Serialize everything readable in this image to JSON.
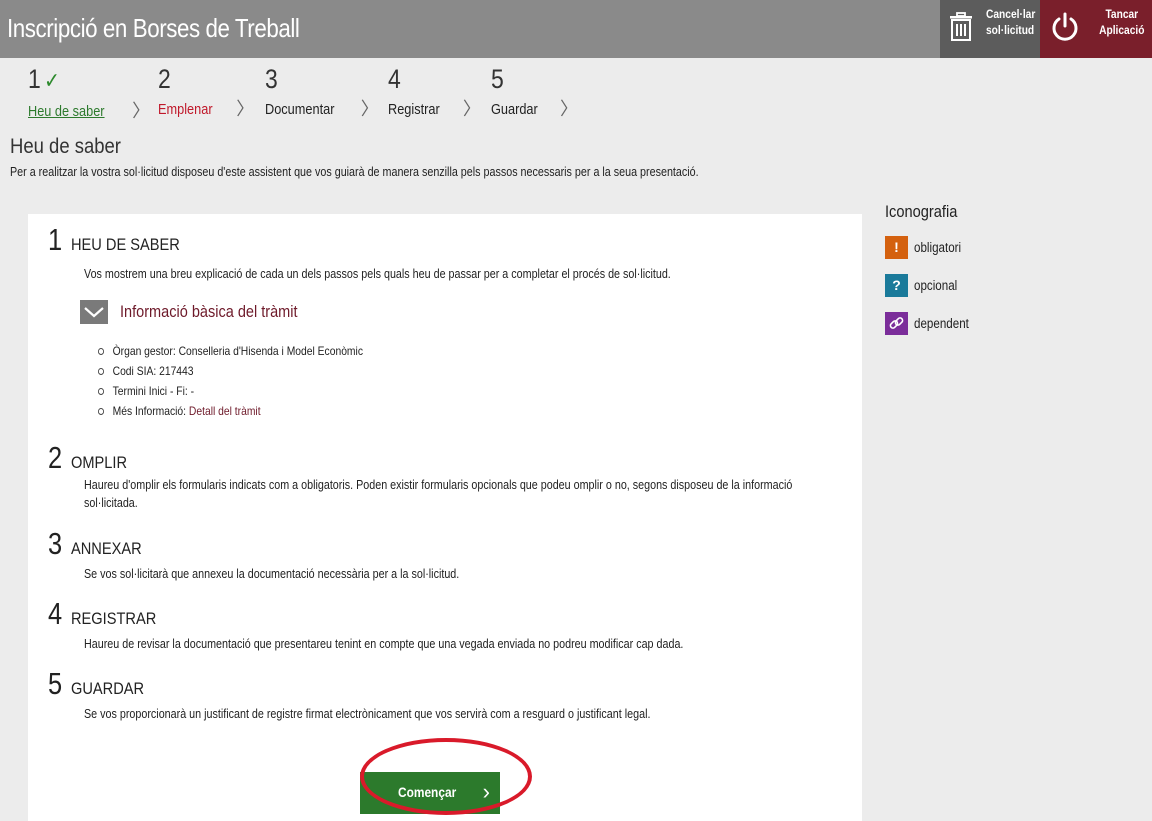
{
  "app": {
    "title": "Inscripció en Borses de Treball",
    "cancel_label_1": "Cancel·lar",
    "cancel_label_2": "sol·licitud",
    "close_label_1": "Tancar",
    "close_label_2": "Aplicació",
    "cancel_icon": "trash-icon",
    "close_icon": "power-icon"
  },
  "steps": [
    {
      "number": "1",
      "label": "Heu de saber",
      "state": "done"
    },
    {
      "number": "2",
      "label": "Emplenar",
      "state": "active"
    },
    {
      "number": "3",
      "label": "Documentar",
      "state": "pending"
    },
    {
      "number": "4",
      "label": "Registrar",
      "state": "pending"
    },
    {
      "number": "5",
      "label": "Guardar",
      "state": "pending"
    }
  ],
  "section": {
    "title": "Heu de saber",
    "subtitle": "Per a realitzar la vostra sol·licitud disposeu d'este assistent que vos guiarà de manera senzilla pels passos necessaris per a la seua presentació."
  },
  "items": [
    {
      "number": "1",
      "heading": "HEU DE SABER",
      "desc": "Vos mostrem una breu explicació de cada un dels passos pels quals heu de passar per a completar el procés de sol·licitud."
    },
    {
      "number": "2",
      "heading": "OMPLIR",
      "desc": "Haureu d'omplir els formularis indicats com a obligatoris. Poden existir formularis opcionals que podeu omplir o no, segons disposeu de la informació sol·licitada."
    },
    {
      "number": "3",
      "heading": "ANNEXAR",
      "desc": "Se vos sol·licitarà que annexeu la documentació necessària per a la sol·licitud."
    },
    {
      "number": "4",
      "heading": "REGISTRAR",
      "desc": "Haureu de revisar la documentació que presentareu tenint en compte que una vegada enviada no podreu modificar cap dada."
    },
    {
      "number": "5",
      "heading": "GUARDAR",
      "desc": "Se vos proporcionarà un justificant de registre firmat electrònicament que vos servirà com a resguard o justificant legal."
    }
  ],
  "info": {
    "toggle_label": "Informació bàsica del tràmit",
    "organ_label": "Òrgan gestor: ",
    "organ_value": "Conselleria d'Hisenda i Model Econòmic",
    "sia_label": "Codi SIA: ",
    "sia_value": "217443",
    "term_label": "Termini Inici - Fi: ",
    "term_value": "-",
    "more_label": "Més Informació: ",
    "more_link": "Detall del tràmit"
  },
  "start_button": {
    "label": "Començar"
  },
  "legend": {
    "title": "Iconografia",
    "items": [
      {
        "symbol": "!",
        "label": "obligatori",
        "color": "#d4610f"
      },
      {
        "symbol": "?",
        "label": "opcional",
        "color": "#1a7a9a"
      },
      {
        "symbol": "link",
        "label": "dependent",
        "color": "#7b2d9a"
      }
    ]
  },
  "colors": {
    "topbar": "#8a8a8a",
    "cancel_button": "#5c5c5c",
    "close_button": "#7a1f2b",
    "done_step": "#2d7a2d",
    "active_step": "#c0182a",
    "start_button": "#2c7a2c",
    "highlight": "#d91a2a"
  }
}
